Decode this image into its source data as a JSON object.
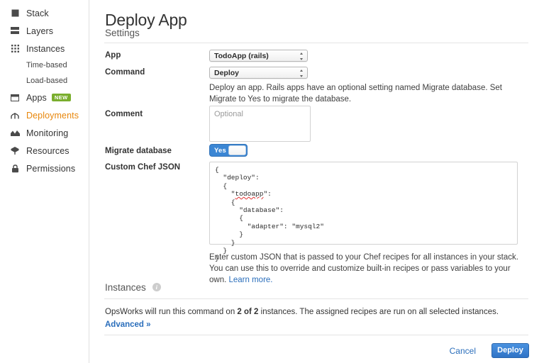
{
  "sidebar": {
    "items": [
      {
        "label": "Stack",
        "icon": "stack-icon",
        "active": false
      },
      {
        "label": "Layers",
        "icon": "layers-icon",
        "active": false
      },
      {
        "label": "Instances",
        "icon": "instances-grid-icon",
        "active": false
      },
      {
        "label": "Apps",
        "icon": "apps-window-icon",
        "active": false,
        "badge": "NEW"
      },
      {
        "label": "Deployments",
        "icon": "deployments-arch-icon",
        "active": true
      },
      {
        "label": "Monitoring",
        "icon": "monitoring-chart-icon",
        "active": false
      },
      {
        "label": "Resources",
        "icon": "resources-cube-icon",
        "active": false
      },
      {
        "label": "Permissions",
        "icon": "permissions-lock-icon",
        "active": false
      }
    ],
    "subitems": [
      {
        "label": "Time-based"
      },
      {
        "label": "Load-based"
      }
    ]
  },
  "page": {
    "title": "Deploy App"
  },
  "settings": {
    "heading": "Settings",
    "app": {
      "label": "App",
      "value": "TodoApp (rails)"
    },
    "command": {
      "label": "Command",
      "value": "Deploy",
      "help": "Deploy an app. Rails apps have an optional setting named Migrate database. Set Migrate to Yes to migrate the database."
    },
    "comment": {
      "label": "Comment",
      "value": "",
      "placeholder": "Optional"
    },
    "migrate": {
      "label": "Migrate database",
      "state": "Yes"
    },
    "custom_json": {
      "label": "Custom Chef JSON",
      "value_line1": "{",
      "value_line2": "  \"deploy\":",
      "value_line3": "  {",
      "value_line4_prefix": "    \"",
      "value_line4_misspelled": "todoapp",
      "value_line4_suffix": "\":",
      "value_line5": "    {",
      "value_line6": "      \"database\":",
      "value_line7": "      {",
      "value_line8": "        \"adapter\": \"mysql2\"",
      "value_line9": "      }",
      "value_line10": "    }",
      "value_line11": "  }",
      "value_line12": "}",
      "help_before_link": "Enter custom JSON that is passed to your Chef recipes for all instances in your stack. You can use this to override and customize built-in recipes or pass variables to your own. ",
      "help_link": "Learn more."
    }
  },
  "instances": {
    "heading": "Instances",
    "info_icon_glyph": "i",
    "description_prefix": "OpsWorks will run this command on ",
    "description_bold": "2 of 2",
    "description_suffix": " instances. The assigned recipes are run on all selected instances.",
    "advanced_link": "Advanced »"
  },
  "footer": {
    "cancel_label": "Cancel",
    "deploy_label": "Deploy"
  },
  "colors": {
    "accent_orange": "#e8870c",
    "link_blue": "#2a6ebb",
    "button_blue": "#3b86d4",
    "badge_green": "#7aae2e"
  }
}
